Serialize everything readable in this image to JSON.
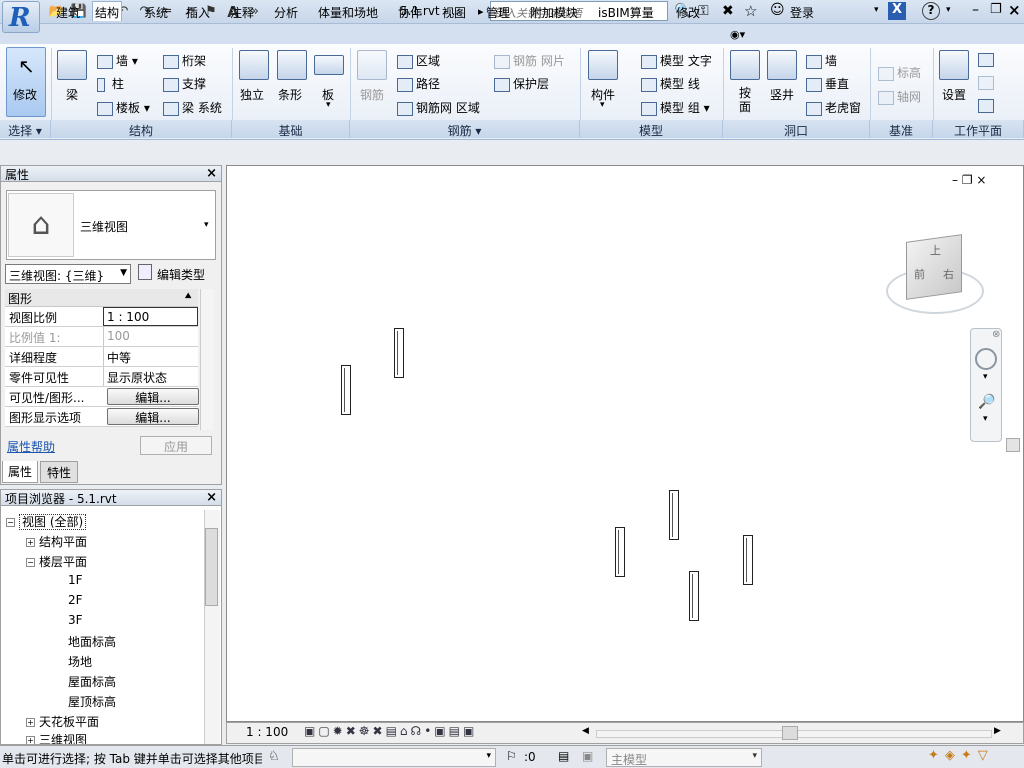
{
  "titlebar": {
    "app_logo": "R",
    "doc_title": "5.1.rvt - ...",
    "search_placeholder": "键入关键字或短语",
    "login_label": "登录",
    "help_icon": "?",
    "quick_access_icons": [
      "open-icon",
      "save-icon",
      "sync-icon",
      "undo-icon",
      "redo-icon",
      "measure-icon",
      "dimension-icon",
      "tag-icon",
      "text-A-icon"
    ]
  },
  "tabs": [
    "建筑",
    "结构",
    "系统",
    "插入",
    "注释",
    "分析",
    "体量和场地",
    "协作",
    "视图",
    "管理",
    "附加模块",
    "isBIM算量",
    "修改"
  ],
  "active_tab": "结构",
  "ribbon": {
    "modify": "修改",
    "beam": "梁",
    "wall": "墙",
    "column": "柱",
    "slab": "楼板",
    "truss": "桁架",
    "brace": "支撑",
    "beam_system": "梁 系统",
    "isolated": "独立",
    "strip": "条形",
    "foundation_slab": "板",
    "rebar": "钢筋",
    "area": "区域",
    "path": "路径",
    "fabric_area": "钢筋网 区域",
    "fabric_sheet": "钢筋 网片",
    "cover": "保护层",
    "component": "构件",
    "model_text": "模型 文字",
    "model_line": "模型 线",
    "model_group": "模型 组",
    "by_face": "按\n面",
    "shaft": "竖井",
    "opening_wall": "墙",
    "vertical": "垂直",
    "dormer": "老虎窗",
    "level": "标高",
    "grid": "轴网",
    "set": "设置",
    "panels": [
      "选择",
      "结构",
      "基础",
      "钢筋",
      "模型",
      "洞口",
      "基准",
      "工作平面"
    ]
  },
  "properties": {
    "title": "属性",
    "type_name": "三维视图",
    "instance_selector": "三维视图: {三维}",
    "edit_type": "编辑类型",
    "section": "图形",
    "rows": [
      {
        "key": "视图比例",
        "value": "1 : 100"
      },
      {
        "key": "比例值 1:",
        "value": "100"
      },
      {
        "key": "详细程度",
        "value": "中等"
      },
      {
        "key": "零件可见性",
        "value": "显示原状态"
      },
      {
        "key": "可见性/图形...",
        "value": "编辑..."
      },
      {
        "key": "图形显示选项",
        "value": "编辑..."
      }
    ],
    "help_link": "属性帮助",
    "apply": "应用",
    "tab_props": "属性",
    "tab_features": "特性"
  },
  "browser": {
    "title": "项目浏览器 - 5.1.rvt",
    "items": [
      "视图 (全部)",
      "结构平面",
      "楼层平面",
      "1F",
      "2F",
      "3F",
      "地面标高",
      "场地",
      "屋面标高",
      "屋顶标高",
      "天花板平面",
      "三维视图"
    ]
  },
  "canvas": {
    "viewcube_front": "前",
    "viewcube_right": "右",
    "viewcube_top": "上"
  },
  "viewctl": {
    "scale": "1 : 100"
  },
  "status": {
    "hint": "单击可进行选择; 按 Tab 键并单击可选择其他项目",
    "count": ":0",
    "model": "主模型"
  }
}
